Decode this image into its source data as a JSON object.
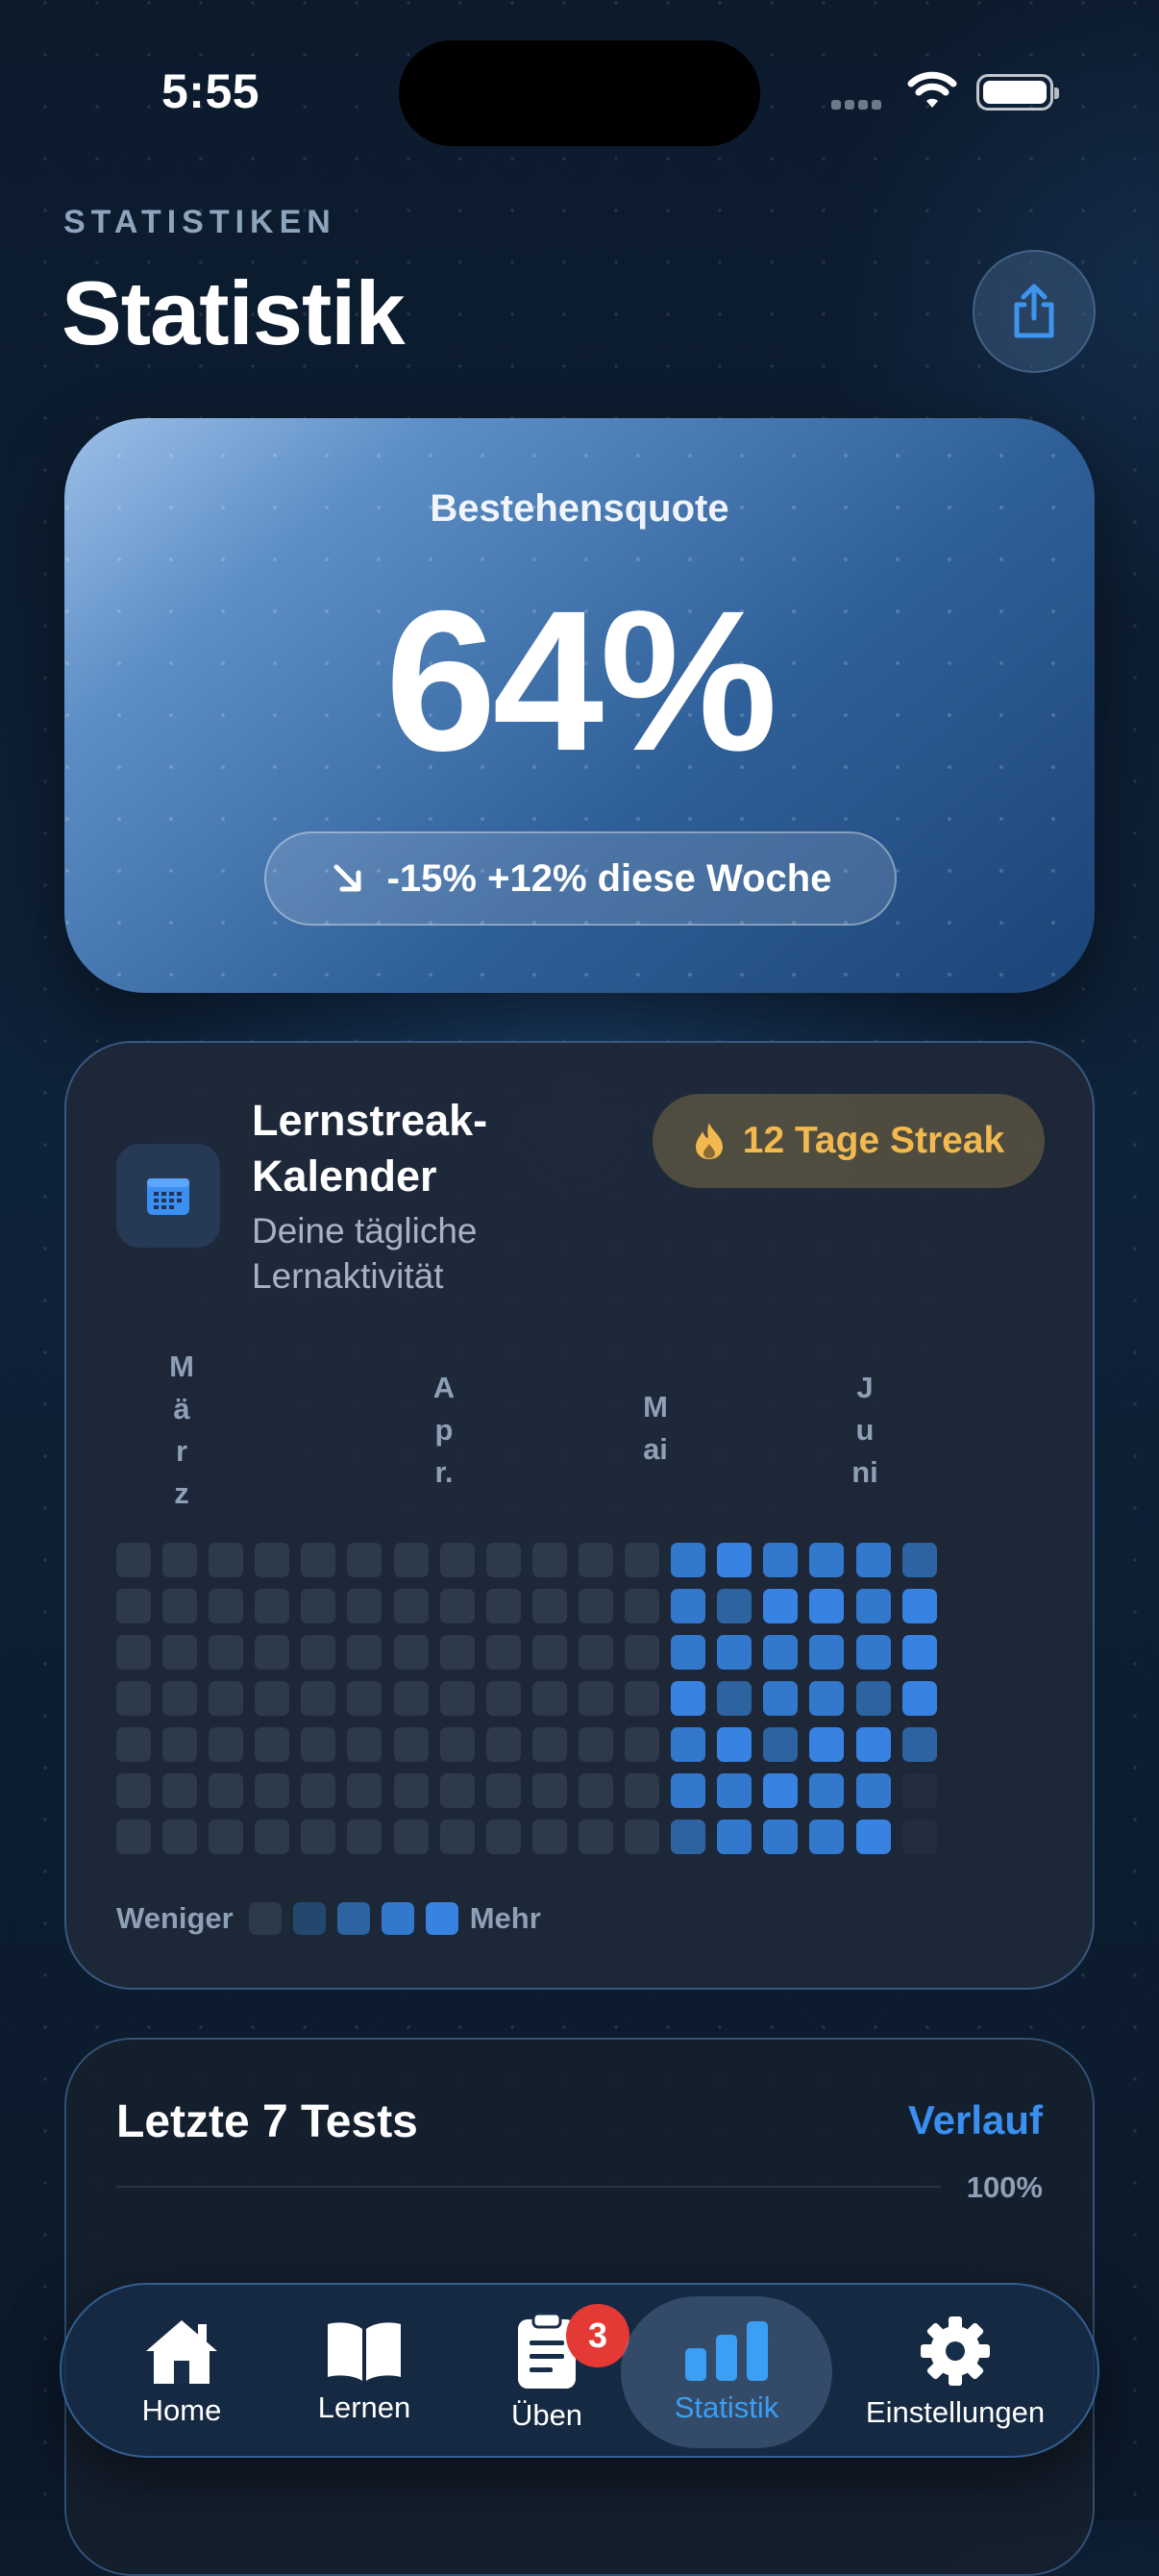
{
  "status_bar": {
    "time": "5:55"
  },
  "header": {
    "eyebrow": "STATISTIKEN",
    "title": "Statistik"
  },
  "pass_rate": {
    "label": "Bestehensquote",
    "value": "64%",
    "trend_text": "-15% +12% diese Woche"
  },
  "streak_calendar": {
    "title": "Lernstreak-Kalender",
    "subtitle": "Deine tägliche Lernaktivität",
    "badge": "12 Tage Streak",
    "months": [
      "März",
      "Apr.",
      "Mai",
      "Juni"
    ],
    "legend_less": "Weniger",
    "legend_more": "Mehr",
    "levels": [
      [
        0,
        0,
        0,
        0,
        0,
        0,
        0
      ],
      [
        0,
        0,
        0,
        0,
        0,
        0,
        0
      ],
      [
        0,
        0,
        0,
        0,
        0,
        0,
        0
      ],
      [
        0,
        0,
        0,
        0,
        0,
        0,
        0
      ],
      [
        0,
        0,
        0,
        0,
        0,
        0,
        0
      ],
      [
        0,
        0,
        0,
        0,
        0,
        0,
        0
      ],
      [
        0,
        0,
        0,
        0,
        0,
        0,
        0
      ],
      [
        0,
        0,
        0,
        0,
        0,
        0,
        0
      ],
      [
        0,
        0,
        0,
        0,
        0,
        0,
        0
      ],
      [
        0,
        0,
        0,
        0,
        0,
        0,
        0
      ],
      [
        0,
        0,
        0,
        0,
        0,
        0,
        0
      ],
      [
        0,
        0,
        0,
        0,
        0,
        0,
        0
      ],
      [
        3,
        3,
        3,
        4,
        3,
        3,
        2
      ],
      [
        4,
        2,
        3,
        2,
        4,
        3,
        3
      ],
      [
        3,
        4,
        3,
        3,
        2,
        4,
        3
      ],
      [
        3,
        4,
        3,
        3,
        4,
        3,
        3
      ],
      [
        3,
        3,
        3,
        2,
        4,
        3,
        4
      ],
      [
        2,
        4,
        4,
        4,
        2,
        -1,
        -1
      ]
    ],
    "colors": [
      "#2c3a4c",
      "#24476e",
      "#2d63a0",
      "#3278cc",
      "#3883e2"
    ]
  },
  "last_tests": {
    "title": "Letzte 7 Tests",
    "link": "Verlauf",
    "axis_max_label": "100%"
  },
  "tab_bar": {
    "items": [
      {
        "label": "Home",
        "icon": "house-icon"
      },
      {
        "label": "Lernen",
        "icon": "book-icon"
      },
      {
        "label": "Üben",
        "icon": "clipboard-icon",
        "badge": "3"
      },
      {
        "label": "Statistik",
        "icon": "chart-bars-icon",
        "active": true
      },
      {
        "label": "Einstellungen",
        "icon": "gear-icon"
      }
    ],
    "active_color": "#3a9ff5"
  }
}
